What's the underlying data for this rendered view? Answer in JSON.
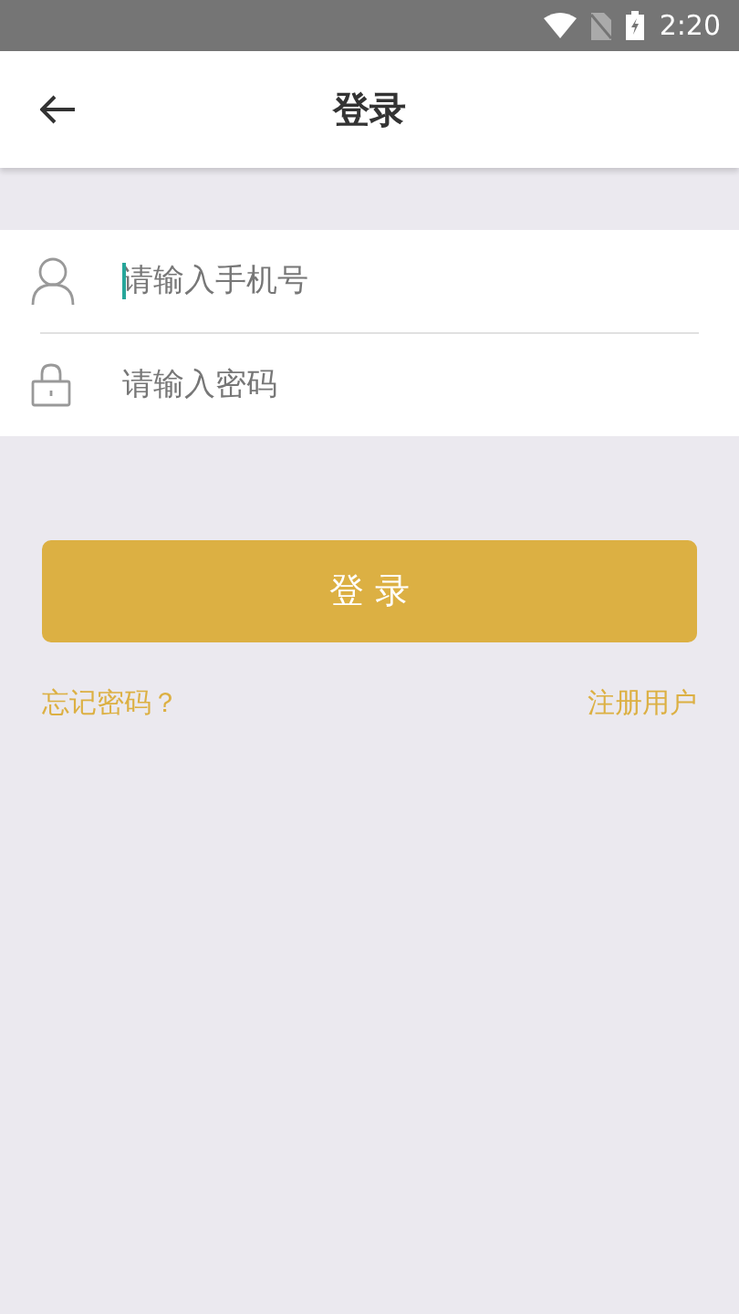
{
  "status_bar": {
    "time": "2:20"
  },
  "header": {
    "title": "登录"
  },
  "fields": [
    {
      "kind": "phone",
      "placeholder": "请输入手机号",
      "focused": true
    },
    {
      "kind": "password",
      "placeholder": "请输入密码",
      "focused": false
    }
  ],
  "login_button": "登 录",
  "links": {
    "forgot_password": "忘记密码？",
    "register": "注册用户"
  }
}
